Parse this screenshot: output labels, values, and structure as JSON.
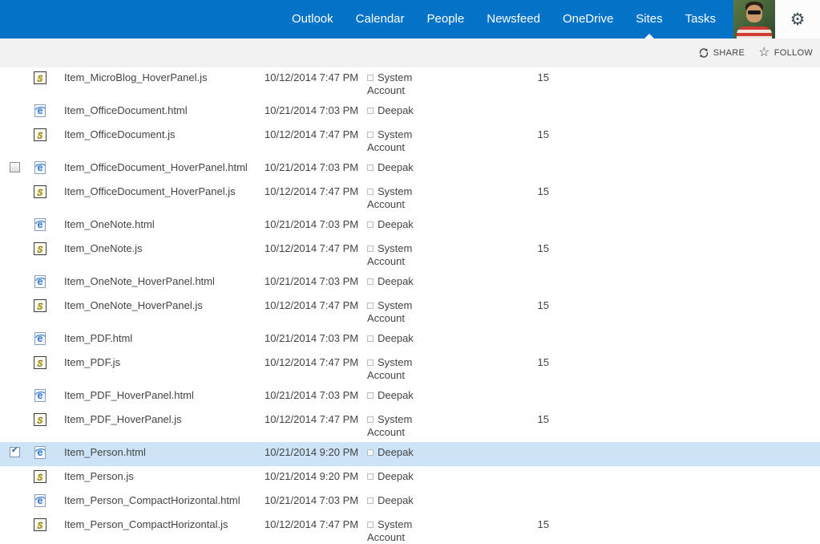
{
  "suite_bar": {
    "bg_color": "#0273c6",
    "nav_items": [
      {
        "label": "Outlook",
        "active": false
      },
      {
        "label": "Calendar",
        "active": false
      },
      {
        "label": "People",
        "active": false
      },
      {
        "label": "Newsfeed",
        "active": false
      },
      {
        "label": "OneDrive",
        "active": false
      },
      {
        "label": "Sites",
        "active": true
      },
      {
        "label": "Tasks",
        "active": false
      }
    ],
    "profile": "user-profile-photo",
    "gear_icon": "settings-gear-icon"
  },
  "actions": {
    "share_label": "SHARE",
    "follow_label": "FOLLOW",
    "share_icon": "share-circular-arrows-icon",
    "follow_icon": "star-outline-icon"
  },
  "file_list": {
    "icon_types": {
      "js": "jscript-file-icon",
      "html": "ie-html-file-icon"
    },
    "selected_row_bg": "#cde3f6",
    "rows": [
      {
        "type": "js",
        "name": "Item_MicroBlog_HoverPanel.js",
        "modified": "10/12/2014 7:47 PM",
        "modified_by": "System Account",
        "rank": "15",
        "checkbox": "none",
        "selected": false
      },
      {
        "type": "html",
        "name": "Item_OfficeDocument.html",
        "modified": "10/21/2014 7:03 PM",
        "modified_by": "Deepak",
        "rank": "",
        "checkbox": "none",
        "selected": false
      },
      {
        "type": "js",
        "name": "Item_OfficeDocument.js",
        "modified": "10/12/2014 7:47 PM",
        "modified_by": "System Account",
        "rank": "15",
        "checkbox": "none",
        "selected": false
      },
      {
        "type": "html",
        "name": "Item_OfficeDocument_HoverPanel.html",
        "modified": "10/21/2014 7:03 PM",
        "modified_by": "Deepak",
        "rank": "",
        "checkbox": "unchecked",
        "selected": false
      },
      {
        "type": "js",
        "name": "Item_OfficeDocument_HoverPanel.js",
        "modified": "10/12/2014 7:47 PM",
        "modified_by": "System Account",
        "rank": "15",
        "checkbox": "none",
        "selected": false
      },
      {
        "type": "html",
        "name": "Item_OneNote.html",
        "modified": "10/21/2014 7:03 PM",
        "modified_by": "Deepak",
        "rank": "",
        "checkbox": "none",
        "selected": false
      },
      {
        "type": "js",
        "name": "Item_OneNote.js",
        "modified": "10/12/2014 7:47 PM",
        "modified_by": "System Account",
        "rank": "15",
        "checkbox": "none",
        "selected": false
      },
      {
        "type": "html",
        "name": "Item_OneNote_HoverPanel.html",
        "modified": "10/21/2014 7:03 PM",
        "modified_by": "Deepak",
        "rank": "",
        "checkbox": "none",
        "selected": false
      },
      {
        "type": "js",
        "name": "Item_OneNote_HoverPanel.js",
        "modified": "10/12/2014 7:47 PM",
        "modified_by": "System Account",
        "rank": "15",
        "checkbox": "none",
        "selected": false
      },
      {
        "type": "html",
        "name": "Item_PDF.html",
        "modified": "10/21/2014 7:03 PM",
        "modified_by": "Deepak",
        "rank": "",
        "checkbox": "none",
        "selected": false
      },
      {
        "type": "js",
        "name": "Item_PDF.js",
        "modified": "10/12/2014 7:47 PM",
        "modified_by": "System Account",
        "rank": "15",
        "checkbox": "none",
        "selected": false
      },
      {
        "type": "html",
        "name": "Item_PDF_HoverPanel.html",
        "modified": "10/21/2014 7:03 PM",
        "modified_by": "Deepak",
        "rank": "",
        "checkbox": "none",
        "selected": false
      },
      {
        "type": "js",
        "name": "Item_PDF_HoverPanel.js",
        "modified": "10/12/2014 7:47 PM",
        "modified_by": "System Account",
        "rank": "15",
        "checkbox": "none",
        "selected": false
      },
      {
        "type": "html",
        "name": "Item_Person.html",
        "modified": "10/21/2014 9:20 PM",
        "modified_by": "Deepak",
        "rank": "",
        "checkbox": "checked",
        "selected": true
      },
      {
        "type": "js",
        "name": "Item_Person.js",
        "modified": "10/21/2014 9:20 PM",
        "modified_by": "Deepak",
        "rank": "",
        "checkbox": "none",
        "selected": false
      },
      {
        "type": "html",
        "name": "Item_Person_CompactHorizontal.html",
        "modified": "10/21/2014 7:03 PM",
        "modified_by": "Deepak",
        "rank": "",
        "checkbox": "none",
        "selected": false
      },
      {
        "type": "js",
        "name": "Item_Person_CompactHorizontal.js",
        "modified": "10/12/2014 7:47 PM",
        "modified_by": "System Account",
        "rank": "15",
        "checkbox": "none",
        "selected": false
      }
    ]
  }
}
